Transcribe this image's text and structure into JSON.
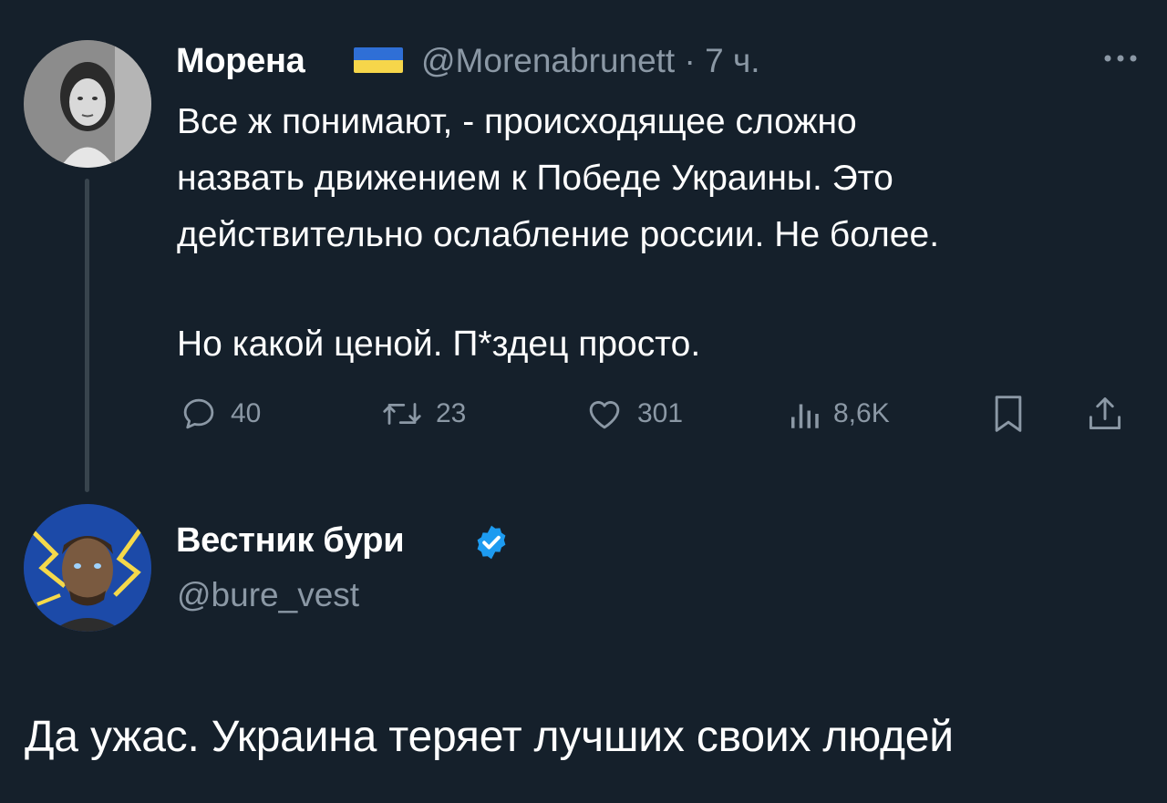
{
  "thread_tweet": {
    "author": {
      "name": "Морена",
      "flag_icon": "ukraine-flag-icon",
      "handle": "@Morenabrunett",
      "time": "· 7 ч."
    },
    "lines": [
      "Все ж понимают, - происходящее сложно",
      "назвать движением к Победе Украины. Это",
      "действительно ослабление россии. Не более.",
      "Но какой ценой. П*здец просто."
    ],
    "actions": {
      "replies": "40",
      "retweets": "23",
      "likes": "301",
      "views": "8,6K"
    },
    "more_icon": "more-icon"
  },
  "focused_tweet": {
    "author": {
      "name": "Вестник бури",
      "handle": "@bure_vest",
      "verified_icon": "verified-badge-icon"
    },
    "text": "Да ужас. Украина теряет лучших своих людей"
  },
  "colors": {
    "background": "#15202b",
    "secondary_text": "#8b98a5",
    "verified_blue": "#1d9bf0",
    "thread_line": "#38444d"
  }
}
